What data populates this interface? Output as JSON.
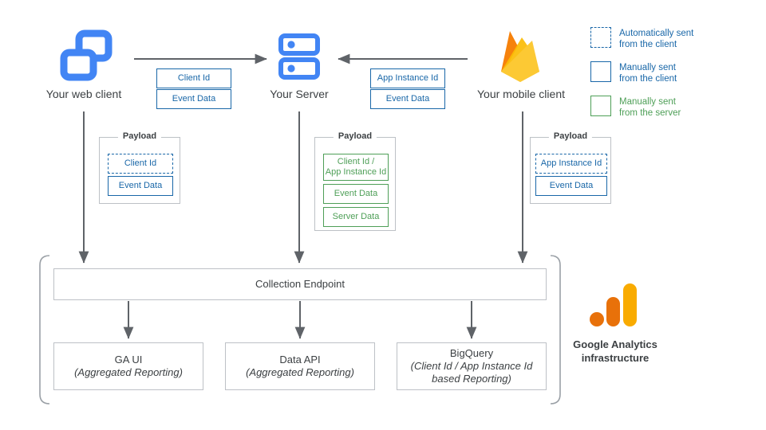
{
  "nodes": {
    "web_client": {
      "label": "Your web client",
      "icon": "web-client-icon"
    },
    "server": {
      "label": "Your Server",
      "icon": "server-icon"
    },
    "mobile_client": {
      "label": "Your mobile client",
      "icon": "firebase-icon"
    }
  },
  "transit_chips": {
    "web_to_server": [
      {
        "label": "Client Id",
        "style": "blue"
      },
      {
        "label": "Event Data",
        "style": "blue"
      }
    ],
    "mobile_to_server": [
      {
        "label": "App Instance Id",
        "style": "blue"
      },
      {
        "label": "Event Data",
        "style": "blue"
      }
    ]
  },
  "payloads": {
    "title": "Payload",
    "web": [
      {
        "label": "Client Id",
        "style": "blue-dashed"
      },
      {
        "label": "Event Data",
        "style": "blue"
      }
    ],
    "server": [
      {
        "label": "Client Id /\nApp Instance Id",
        "style": "green"
      },
      {
        "label": "Event Data",
        "style": "green"
      },
      {
        "label": "Server Data",
        "style": "green"
      }
    ],
    "mobile": [
      {
        "label": "App Instance Id",
        "style": "blue-dashed"
      },
      {
        "label": "Event Data",
        "style": "blue"
      }
    ]
  },
  "collection_endpoint": {
    "label": "Collection Endpoint"
  },
  "destinations": [
    {
      "title": "GA UI",
      "subtitle": "(Aggregated Reporting)"
    },
    {
      "title": "Data API",
      "subtitle": "(Aggregated Reporting)"
    },
    {
      "title": "BigQuery",
      "subtitle": "(Client Id / App Instance Id\nbased Reporting)"
    }
  ],
  "infrastructure": {
    "caption_line1": "Google Analytics",
    "caption_line2": "infrastructure",
    "icon": "google-analytics-logo"
  },
  "legend": [
    {
      "swatch": "dashed-blue",
      "line1": "Automatically sent",
      "line2": "from the client",
      "color": "#1967a8"
    },
    {
      "swatch": "solid-blue",
      "line1": "Manually sent",
      "line2": "from the client",
      "color": "#1967a8"
    },
    {
      "swatch": "solid-green",
      "line1": "Manually sent",
      "line2": "from the server",
      "color": "#4e9f57"
    }
  ],
  "colors": {
    "blue": "#1967a8",
    "green": "#4e9f57",
    "icon_blue": "#4285f4",
    "arrow_grey": "#5f6368",
    "border_grey": "#bdc1c6",
    "ga_orange_dark": "#e8710a",
    "ga_orange_light": "#f9ab00",
    "firebase_yellow": "#ffc24a",
    "firebase_orange": "#f4bd62"
  }
}
